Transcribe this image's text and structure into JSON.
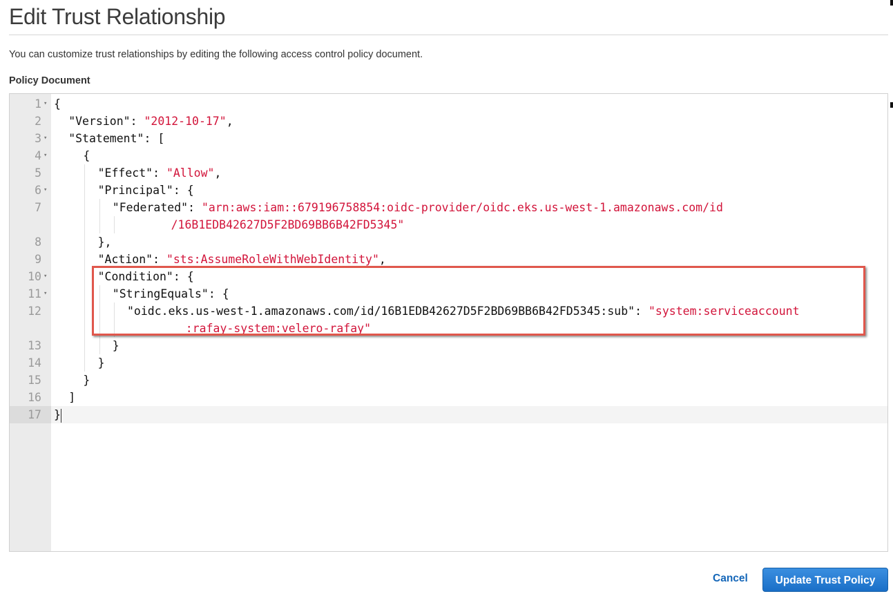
{
  "page": {
    "title": "Edit Trust Relationship",
    "description": "You can customize trust relationships by editing the following access control policy document.",
    "editor_label": "Policy Document"
  },
  "editor": {
    "lines": [
      {
        "n": "1",
        "fold": true,
        "indent": 0,
        "parts": [
          {
            "t": "{",
            "s": false
          }
        ]
      },
      {
        "n": "2",
        "fold": false,
        "indent": 1,
        "parts": [
          {
            "t": "\"Version\": ",
            "s": false
          },
          {
            "t": "\"2012-10-17\"",
            "s": true
          },
          {
            "t": ",",
            "s": false
          }
        ]
      },
      {
        "n": "3",
        "fold": true,
        "indent": 1,
        "parts": [
          {
            "t": "\"Statement\": [",
            "s": false
          }
        ]
      },
      {
        "n": "4",
        "fold": true,
        "indent": 2,
        "parts": [
          {
            "t": "{",
            "s": false
          }
        ]
      },
      {
        "n": "5",
        "fold": false,
        "indent": 3,
        "parts": [
          {
            "t": "\"Effect\": ",
            "s": false
          },
          {
            "t": "\"Allow\"",
            "s": true
          },
          {
            "t": ",",
            "s": false
          }
        ]
      },
      {
        "n": "6",
        "fold": true,
        "indent": 3,
        "parts": [
          {
            "t": "\"Principal\": {",
            "s": false
          }
        ]
      },
      {
        "n": "7",
        "fold": false,
        "indent": 4,
        "parts": [
          {
            "t": "\"Federated\": ",
            "s": false
          },
          {
            "t": "\"arn:aws:iam::679196758854:oidc-provider/oidc.eks.us-west-1.amazonaws.com/id",
            "s": true
          }
        ]
      },
      {
        "n": "",
        "fold": false,
        "indent": 8,
        "parts": [
          {
            "t": "/16B1EDB42627D5F2BD69BB6B42FD5345\"",
            "s": true
          }
        ]
      },
      {
        "n": "8",
        "fold": false,
        "indent": 3,
        "parts": [
          {
            "t": "},",
            "s": false
          }
        ]
      },
      {
        "n": "9",
        "fold": false,
        "indent": 3,
        "parts": [
          {
            "t": "\"Action\": ",
            "s": false
          },
          {
            "t": "\"sts:AssumeRoleWithWebIdentity\"",
            "s": true
          },
          {
            "t": ",",
            "s": false
          }
        ]
      },
      {
        "n": "10",
        "fold": true,
        "indent": 3,
        "parts": [
          {
            "t": "\"Condition\": {",
            "s": false
          }
        ]
      },
      {
        "n": "11",
        "fold": true,
        "indent": 4,
        "parts": [
          {
            "t": "\"StringEquals\": {",
            "s": false
          }
        ]
      },
      {
        "n": "12",
        "fold": false,
        "indent": 5,
        "parts": [
          {
            "t": "\"oidc.eks.us-west-1.amazonaws.com/id/16B1EDB42627D5F2BD69BB6B42FD5345:sub\": ",
            "s": false
          },
          {
            "t": "\"system:serviceaccount",
            "s": true
          }
        ]
      },
      {
        "n": "",
        "fold": false,
        "indent": 9,
        "parts": [
          {
            "t": ":rafay-system:velero-rafay\"",
            "s": true
          }
        ]
      },
      {
        "n": "13",
        "fold": false,
        "indent": 4,
        "parts": [
          {
            "t": "}",
            "s": false
          }
        ]
      },
      {
        "n": "14",
        "fold": false,
        "indent": 3,
        "parts": [
          {
            "t": "}",
            "s": false
          }
        ]
      },
      {
        "n": "15",
        "fold": false,
        "indent": 2,
        "parts": [
          {
            "t": "}",
            "s": false
          }
        ]
      },
      {
        "n": "16",
        "fold": false,
        "indent": 1,
        "parts": [
          {
            "t": "]",
            "s": false
          }
        ]
      },
      {
        "n": "17",
        "fold": false,
        "indent": 0,
        "active": true,
        "parts": [
          {
            "t": "}",
            "s": false
          }
        ]
      }
    ]
  },
  "actions": {
    "cancel_label": "Cancel",
    "submit_label": "Update Trust Policy"
  },
  "colors": {
    "string": "#d2143a",
    "highlight_box": "#e0574c",
    "primary_button": "#1a6fc7",
    "link": "#1466b8"
  }
}
